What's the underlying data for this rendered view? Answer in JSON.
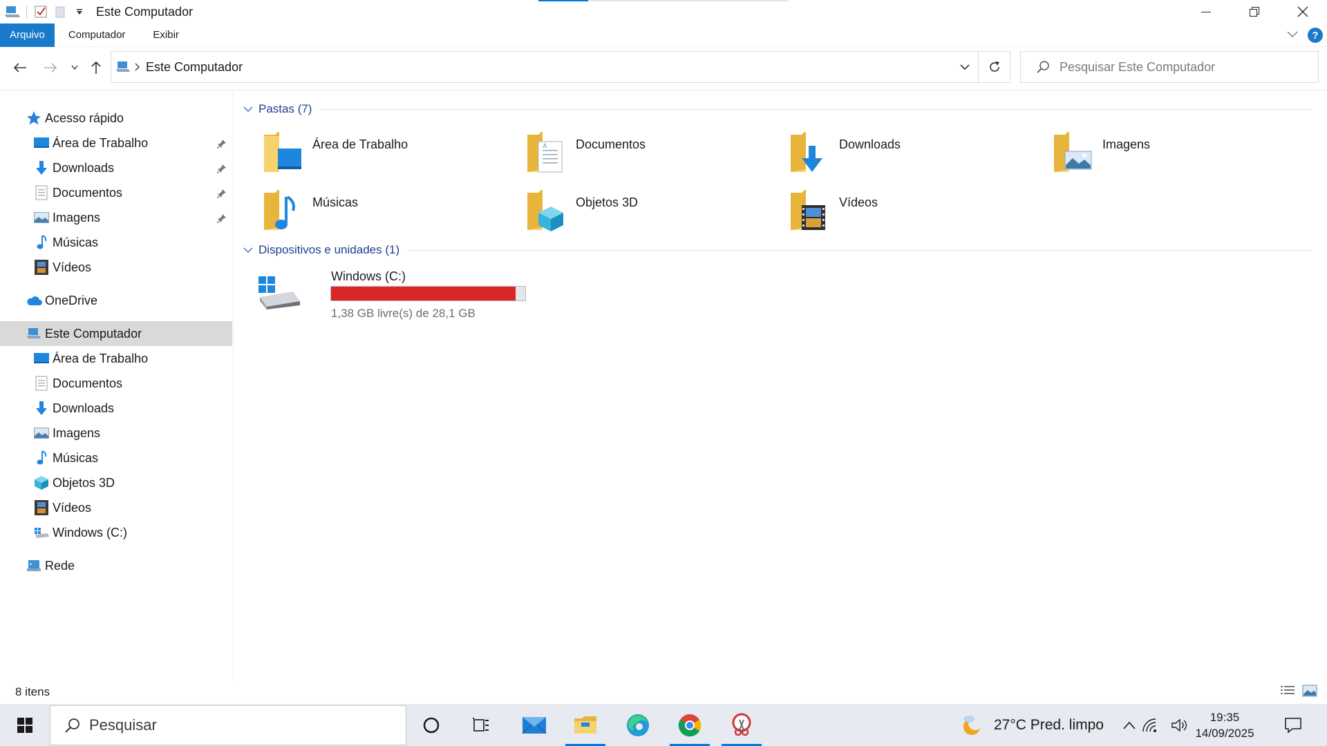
{
  "window": {
    "title": "Este Computador",
    "accent": "#1979ca"
  },
  "ribbon": {
    "tabs": [
      "Arquivo",
      "Computador",
      "Exibir"
    ]
  },
  "address": {
    "breadcrumb": "Este Computador",
    "search_placeholder": "Pesquisar Este Computador"
  },
  "sidebar": {
    "quick_access": "Acesso rápido",
    "quick_items": [
      "Área de Trabalho",
      "Downloads",
      "Documentos",
      "Imagens",
      "Músicas",
      "Vídeos"
    ],
    "onedrive": "OneDrive",
    "this_pc": "Este Computador",
    "pc_items": [
      "Área de Trabalho",
      "Documentos",
      "Downloads",
      "Imagens",
      "Músicas",
      "Objetos 3D",
      "Vídeos",
      "Windows (C:)"
    ],
    "network": "Rede"
  },
  "content": {
    "folders_header": "Pastas (7)",
    "folders": [
      "Área de Trabalho",
      "Documentos",
      "Downloads",
      "Imagens",
      "Músicas",
      "Objetos 3D",
      "Vídeos"
    ],
    "devices_header": "Dispositivos e unidades (1)",
    "drive": {
      "name": "Windows (C:)",
      "info": "1,38 GB livre(s) de 28,1 GB",
      "used_fraction": 0.951,
      "bar_color": "#da2626"
    }
  },
  "status": {
    "item_count": "8 itens"
  },
  "taskbar": {
    "search_label": "Pesquisar",
    "weather": "27°C  Pred. limpo",
    "time": "19:35",
    "date": "14/09/2025"
  }
}
